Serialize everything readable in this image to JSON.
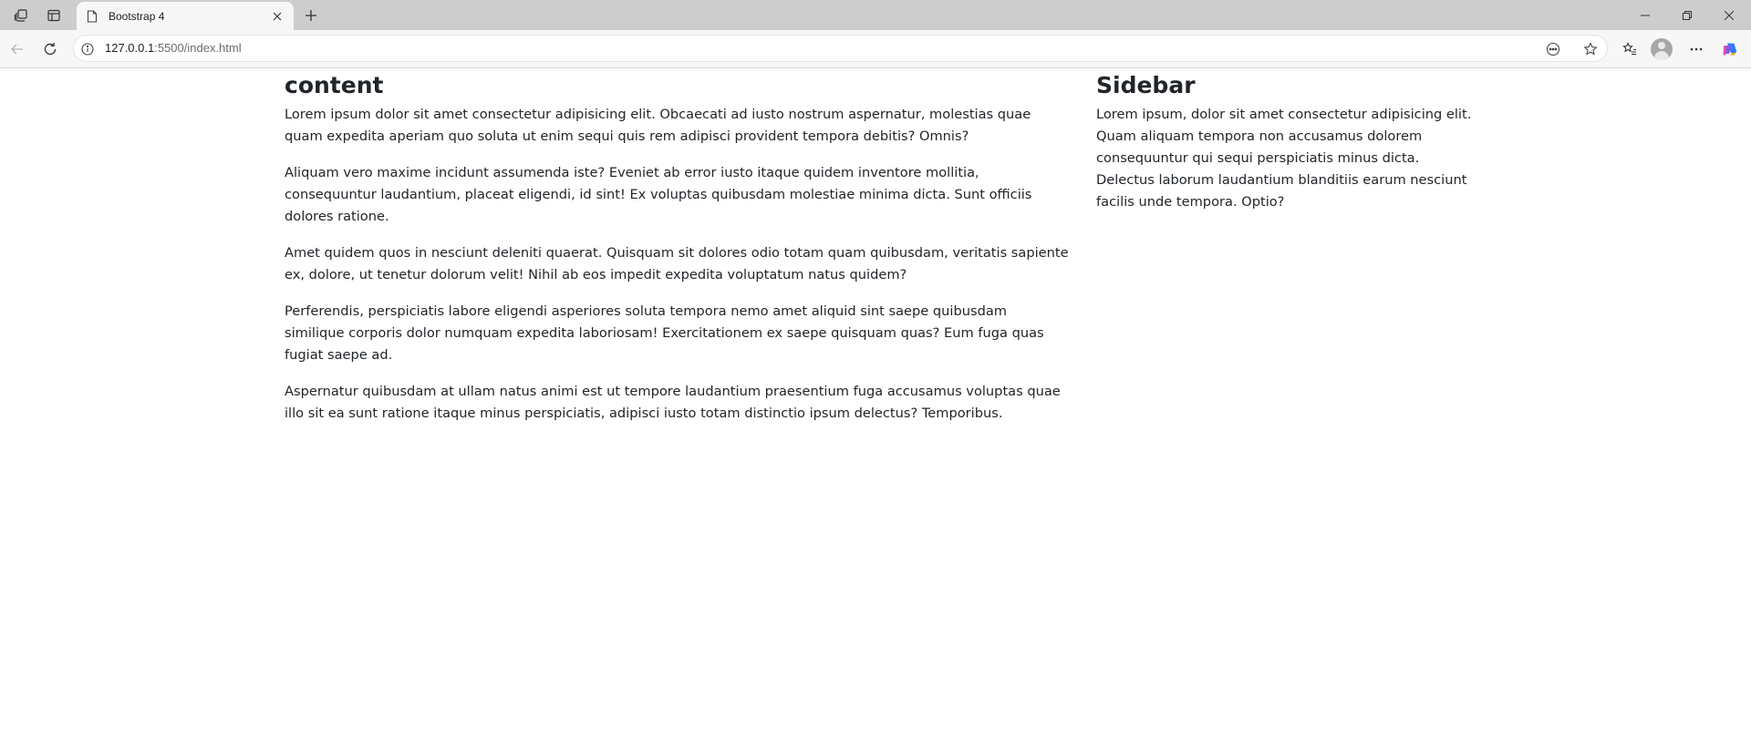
{
  "browser": {
    "tab": {
      "title": "Bootstrap 4"
    },
    "address": {
      "host": "127.0.0.1",
      "rest": ":5500/index.html"
    }
  },
  "page": {
    "main": {
      "heading": "content",
      "paragraphs": [
        "Lorem ipsum dolor sit amet consectetur adipisicing elit. Obcaecati ad iusto nostrum aspernatur, molestias quae quam expedita aperiam quo soluta ut enim sequi quis rem adipisci provident tempora debitis? Omnis?",
        "Aliquam vero maxime incidunt assumenda iste? Eveniet ab error iusto itaque quidem inventore mollitia, consequuntur laudantium, placeat eligendi, id sint! Ex voluptas quibusdam molestiae minima dicta. Sunt officiis dolores ratione.",
        "Amet quidem quos in nesciunt deleniti quaerat. Quisquam sit dolores odio totam quam quibusdam, veritatis sapiente ex, dolore, ut tenetur dolorum velit! Nihil ab eos impedit expedita voluptatum natus quidem?",
        "Perferendis, perspiciatis labore eligendi asperiores soluta tempora nemo amet aliquid sint saepe quibusdam similique corporis dolor numquam expedita laboriosam! Exercitationem ex saepe quisquam quas? Eum fuga quas fugiat saepe ad.",
        "Aspernatur quibusdam at ullam natus animi est ut tempore laudantium praesentium fuga accusamus voluptas quae illo sit ea sunt ratione itaque minus perspiciatis, adipisci iusto totam distinctio ipsum delectus? Temporibus."
      ]
    },
    "sidebar": {
      "heading": "Sidebar",
      "paragraph": "Lorem ipsum, dolor sit amet consectetur adipisicing elit. Quam aliquam tempora non accusamus dolorem consequuntur qui sequi perspiciatis minus dicta. Delectus laborum laudantium blanditiis earum nesciunt facilis unde tempora. Optio?"
    }
  },
  "icons": {
    "workspaces": "workspaces-icon",
    "tab_actions": "tab-actions-icon",
    "page": "page-icon",
    "close": "close-icon",
    "new_tab": "plus-icon",
    "minimize": "minimize-icon",
    "restore": "restore-icon",
    "back": "back-arrow-icon",
    "refresh": "refresh-icon",
    "info": "info-icon",
    "read_aloud": "more-circle-icon",
    "favorite": "star-icon",
    "favorites": "favorites-icon",
    "profile": "avatar",
    "menu": "ellipsis-icon",
    "copilot": "copilot-icon"
  }
}
